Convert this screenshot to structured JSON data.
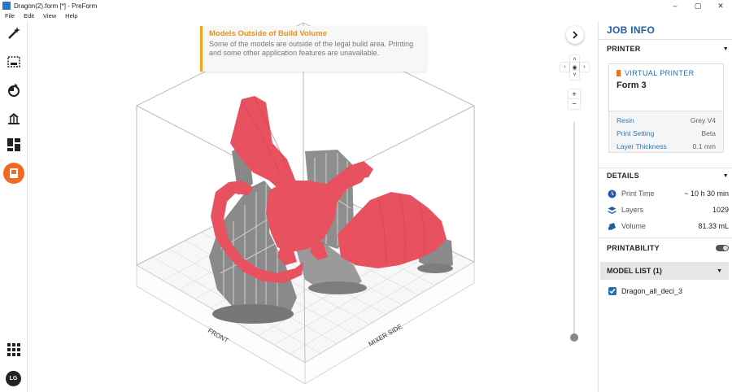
{
  "window": {
    "title": "Dragon(2).form [*] - PreForm",
    "minimize": "–",
    "maximize": "▢",
    "close": "✕"
  },
  "menu": [
    "File",
    "Edit",
    "View",
    "Help"
  ],
  "toolbar": {
    "avatar_initials": "LG"
  },
  "alert": {
    "title": "Models Outside of Build Volume",
    "body": "Some of the models are outside of the legal build area. Printing and some other application features are unavailable."
  },
  "viewport": {
    "front_label": "FRONT",
    "side_label": "MIXER SIDE",
    "zoom_in": "+",
    "zoom_out": "−"
  },
  "panel": {
    "title": "JOB INFO",
    "printer_section": "PRINTER",
    "printer_type": "VIRTUAL PRINTER",
    "printer_name": "Form 3",
    "settings": [
      {
        "label": "Resin",
        "value": "Grey V4"
      },
      {
        "label": "Print Setting",
        "value": "Beta"
      },
      {
        "label": "Layer Thickness",
        "value": "0.1 mm"
      }
    ],
    "details_section": "DETAILS",
    "details": [
      {
        "label": "Print Time",
        "value": "~ 10 h 30 min"
      },
      {
        "label": "Layers",
        "value": "1029"
      },
      {
        "label": "Volume",
        "value": "81.33 mL"
      }
    ],
    "printability": "PRINTABILITY",
    "model_list": "MODEL LIST (1)",
    "model_name": "Dragon_all_deci_3"
  },
  "colors": {
    "accent_blue": "#1f5fa6",
    "accent_orange": "#ef6a22",
    "warning": "#f2a81d",
    "model_red": "#e8515f"
  }
}
